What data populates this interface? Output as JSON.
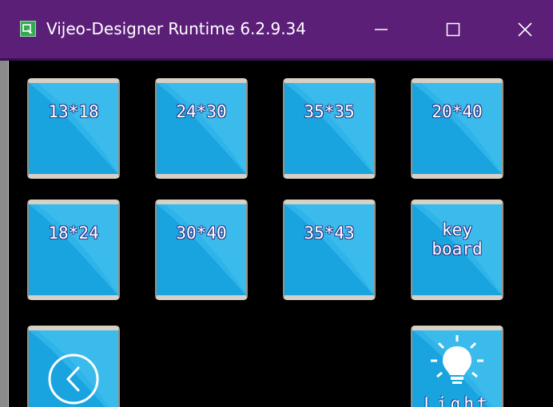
{
  "window": {
    "title": "Vijeo-Designer Runtime 6.2.9.34",
    "icon": "app-window-icon",
    "controls": {
      "minimize_icon": "minimize-icon",
      "maximize_icon": "maximize-icon",
      "close_icon": "close-icon"
    }
  },
  "colors": {
    "titlebar": "#5b1f78",
    "tile": "#1aa4df",
    "tile_border": "#d8d0c4",
    "background": "#000000",
    "app_icon": "#34a853"
  },
  "grid": {
    "row1": [
      "13*18",
      "24*30",
      "35*35",
      "20*40"
    ],
    "row2": [
      "18*24",
      "30*40",
      "35*43"
    ],
    "keyboard": [
      "key",
      "board"
    ],
    "back_icon": "chevron-left-circle-icon",
    "light_icon": "light-bulb-icon",
    "light_label": "Light"
  }
}
